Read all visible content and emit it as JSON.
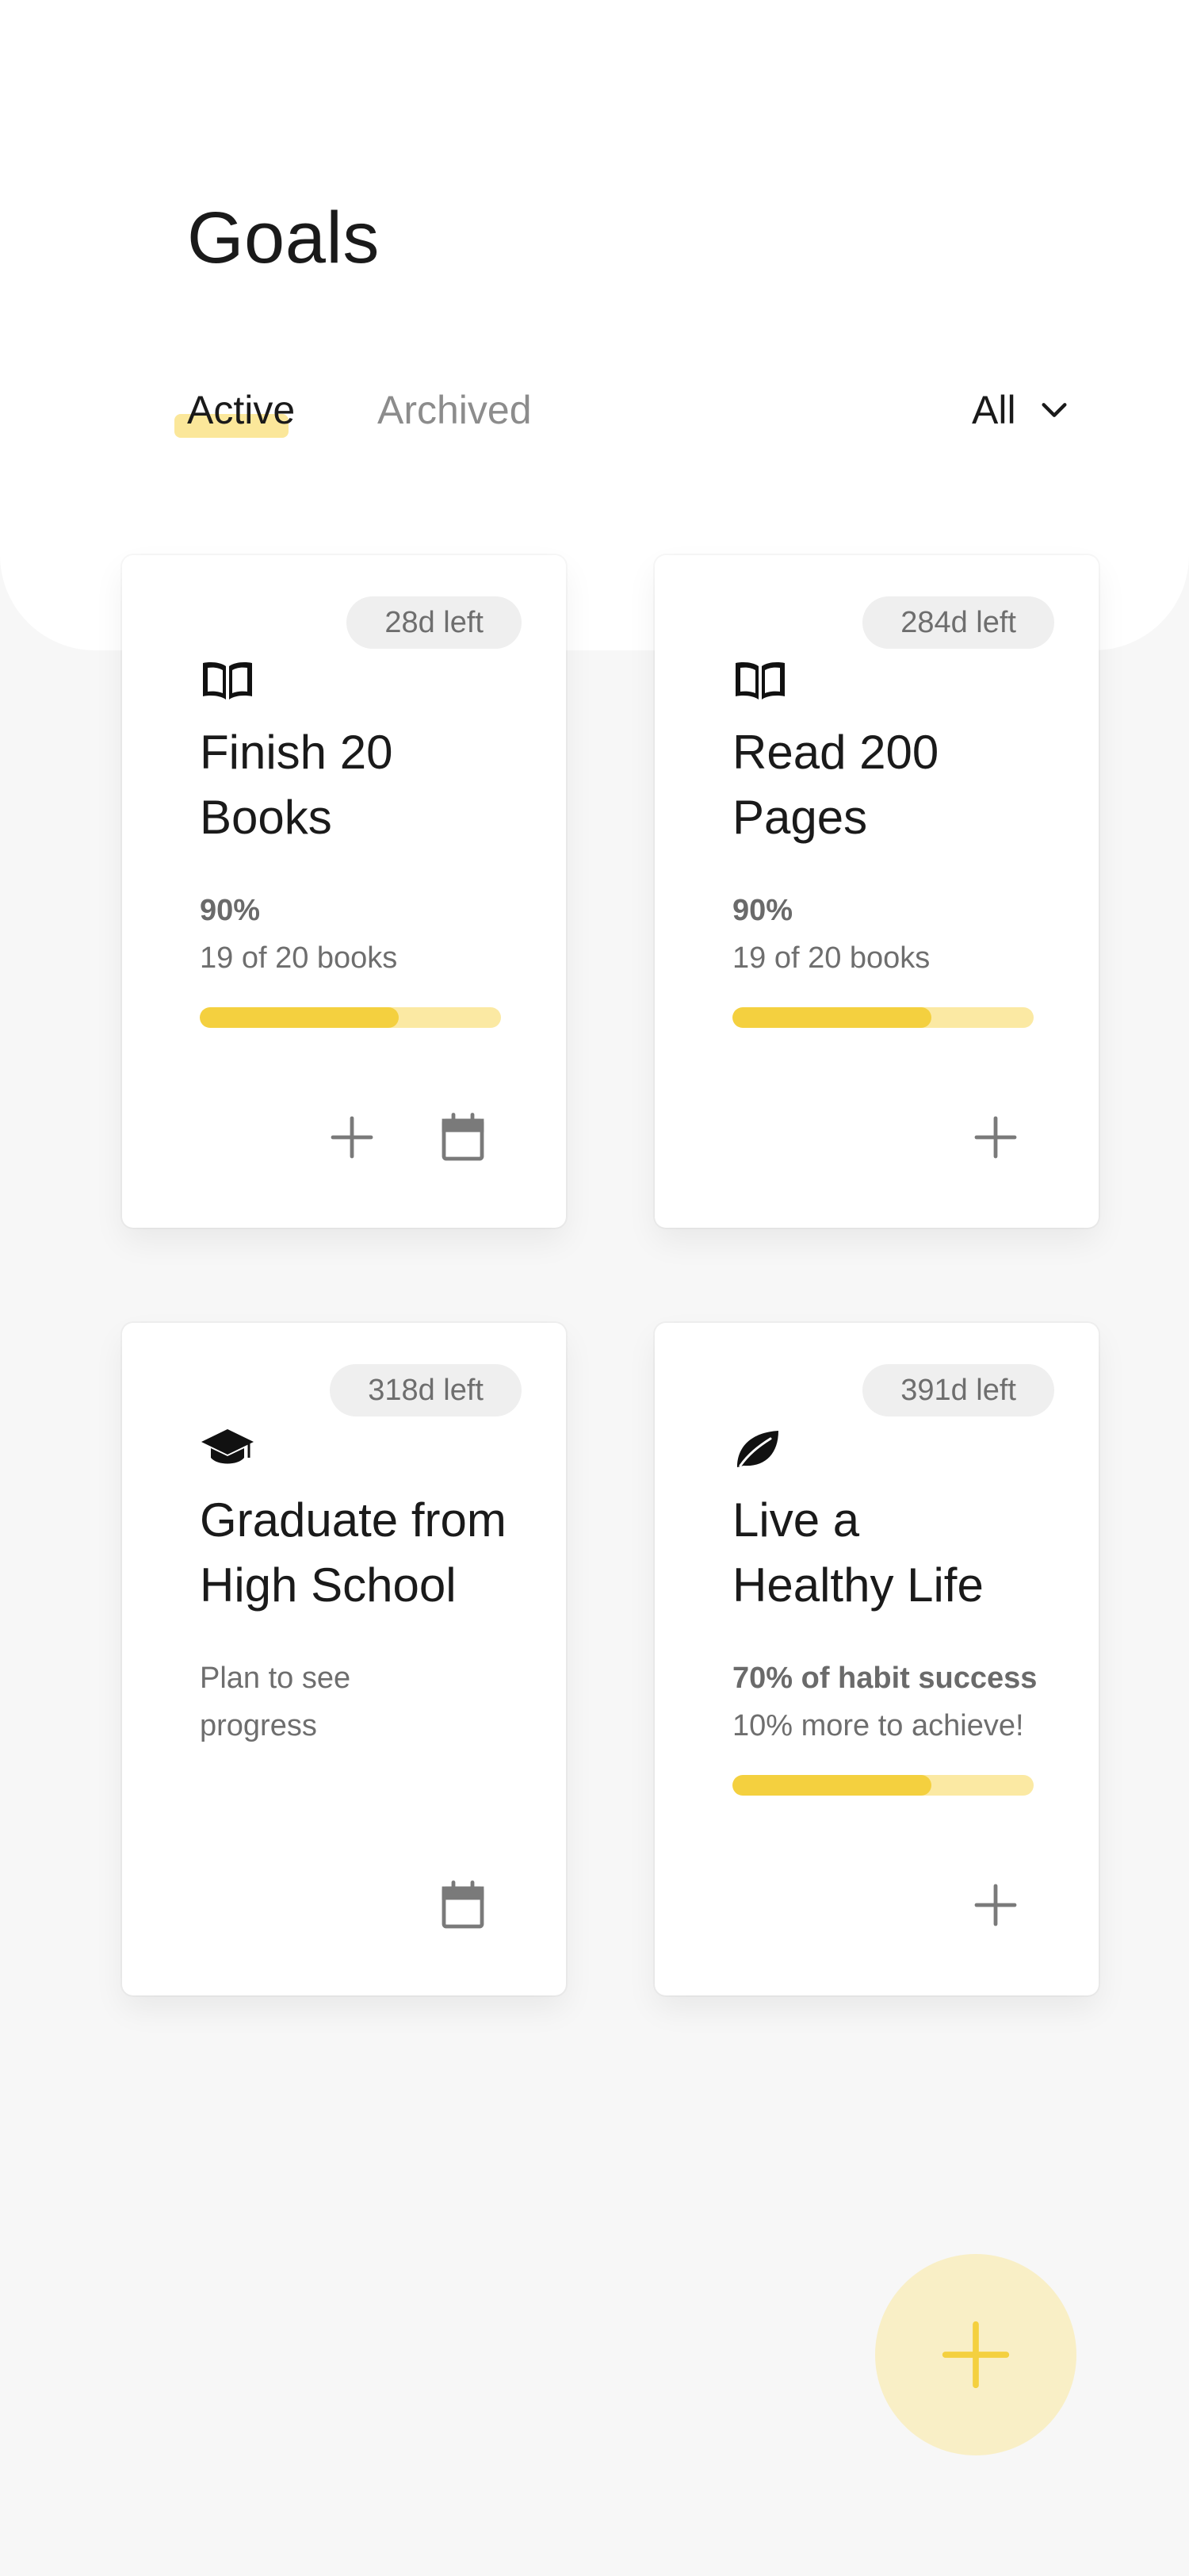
{
  "header": {
    "title": "Goals",
    "tabs": [
      {
        "label": "Active",
        "active": true
      },
      {
        "label": "Archived",
        "active": false
      }
    ],
    "filter": {
      "label": "All",
      "icon": "chevron-down-icon"
    }
  },
  "goals": [
    {
      "badge": "28d left",
      "icon": "book-icon",
      "title_line1": "Finish 20",
      "title_line2": "Books",
      "stat_primary": "90%",
      "stat_secondary": "19 of 20 books",
      "progress": 0.66,
      "actions": [
        "plus-icon",
        "calendar-icon"
      ]
    },
    {
      "badge": "284d left",
      "icon": "book-icon",
      "title_line1": "Read 200",
      "title_line2": "Pages",
      "stat_primary": "90%",
      "stat_secondary": "19 of 20 books",
      "progress": 0.66,
      "actions": [
        "plus-icon"
      ]
    },
    {
      "badge": "318d left",
      "icon": "graduation-cap-icon",
      "title_line1": "Graduate from",
      "title_line2": "High School",
      "stat_primary": "Plan to see",
      "stat_secondary": "progress",
      "actions": [
        "calendar-icon"
      ]
    },
    {
      "badge": "391d left",
      "icon": "leaf-icon",
      "title_line1": "Live a",
      "title_line2": "Healthy Life",
      "stat_primary": "70% of habit success",
      "stat_secondary": "10% more to achieve!",
      "progress": 0.66,
      "actions": [
        "plus-icon"
      ]
    }
  ],
  "fab": {
    "icon": "plus-icon"
  },
  "colors": {
    "accent": "#f4d03f",
    "accent_light": "#fbe9a3",
    "fab_bg": "#f9efc6",
    "background": "#f7f7f7",
    "text": "#1a1a1a",
    "muted": "#8c8c8c"
  }
}
